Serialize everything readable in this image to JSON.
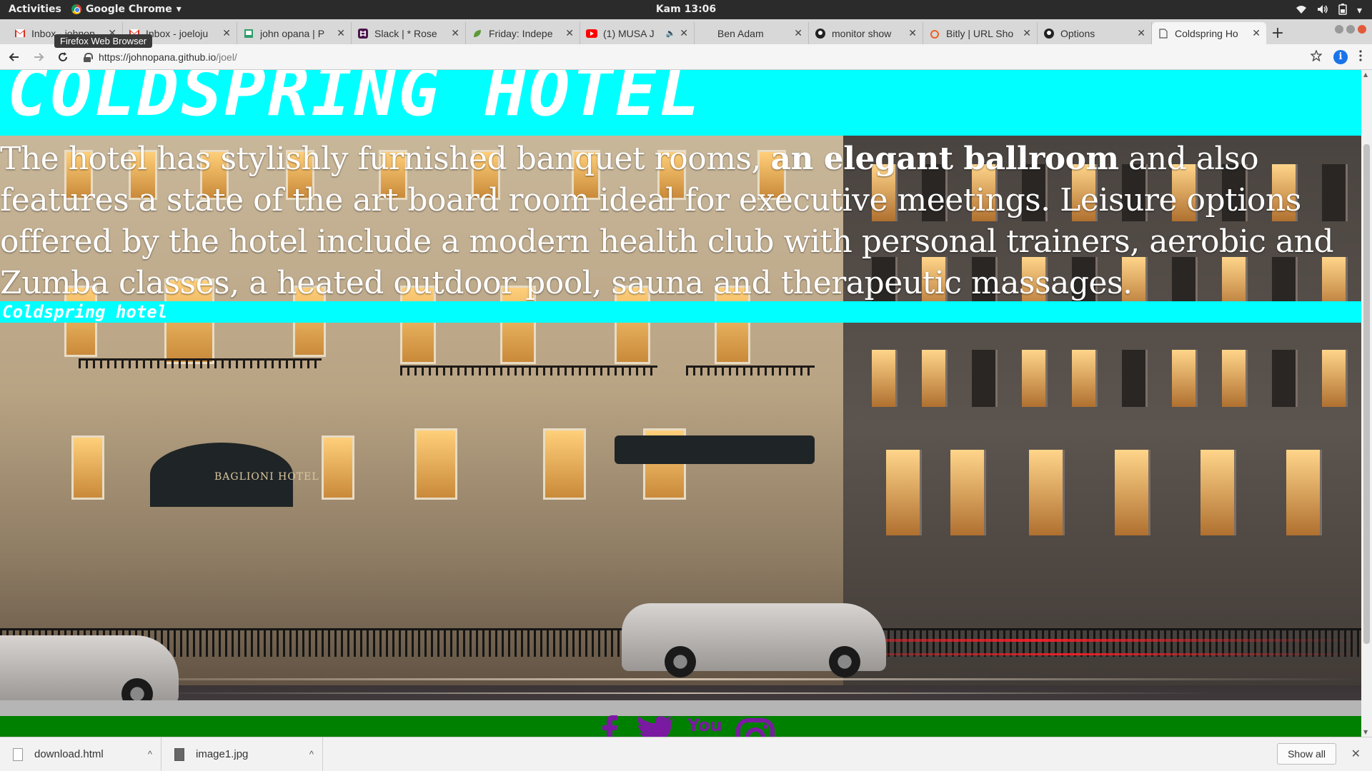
{
  "system": {
    "activities": "Activities",
    "app_name": "Google Chrome",
    "app_menu_arrow": "▾",
    "clock": "Kam 13:06"
  },
  "tooltip": "Firefox Web Browser",
  "tabs": [
    {
      "title": "Inbox - johnop",
      "icon": "gmail-icon"
    },
    {
      "title": "Inbox - joeloju",
      "icon": "gmail-icon"
    },
    {
      "title": "john opana | P",
      "icon": "page-icon"
    },
    {
      "title": "Slack | * Rose",
      "icon": "slack-icon"
    },
    {
      "title": "Friday: Indepe",
      "icon": "leaf-icon"
    },
    {
      "title": "(1) MUSA J",
      "icon": "youtube-icon"
    },
    {
      "title": "Ben Adam",
      "icon": "blank-icon"
    },
    {
      "title": "monitor show",
      "icon": "github-icon"
    },
    {
      "title": "Bitly | URL Sho",
      "icon": "bitly-icon"
    },
    {
      "title": "Options",
      "icon": "github-icon"
    },
    {
      "title": "Coldspring Ho",
      "icon": "document-icon",
      "active": true
    }
  ],
  "address_bar": {
    "url_host": "https://johnopana.github.io",
    "url_path": "/joel/"
  },
  "page": {
    "title": "COLDSPRING HOTEL",
    "description_part1": "The hotel has stylishly furnished banquet rooms, ",
    "description_bold": "an elegant ballroom",
    "description_part2": " and also features a state of the art board room ideal for executive meetings. Leisure options offered by the hotel include a modern health club with personal trainers, aerobic and Zumba classes, a heated outdoor pool, sauna and therapeutic massages.",
    "subtitle": "Coldspring hotel",
    "image_sign": "BAGLIONI HOTEL",
    "social_icons": [
      "facebook-icon",
      "twitter-icon",
      "youtube-icon",
      "instagram-icon"
    ],
    "youtube_text": "You"
  },
  "downloads": [
    {
      "name": "download.html",
      "type": "html"
    },
    {
      "name": "image1.jpg",
      "type": "image"
    }
  ],
  "show_all": "Show all",
  "colors": {
    "cyan": "#00ffff",
    "footer_green": "#008000",
    "social_purple": "#7a1aa0"
  }
}
